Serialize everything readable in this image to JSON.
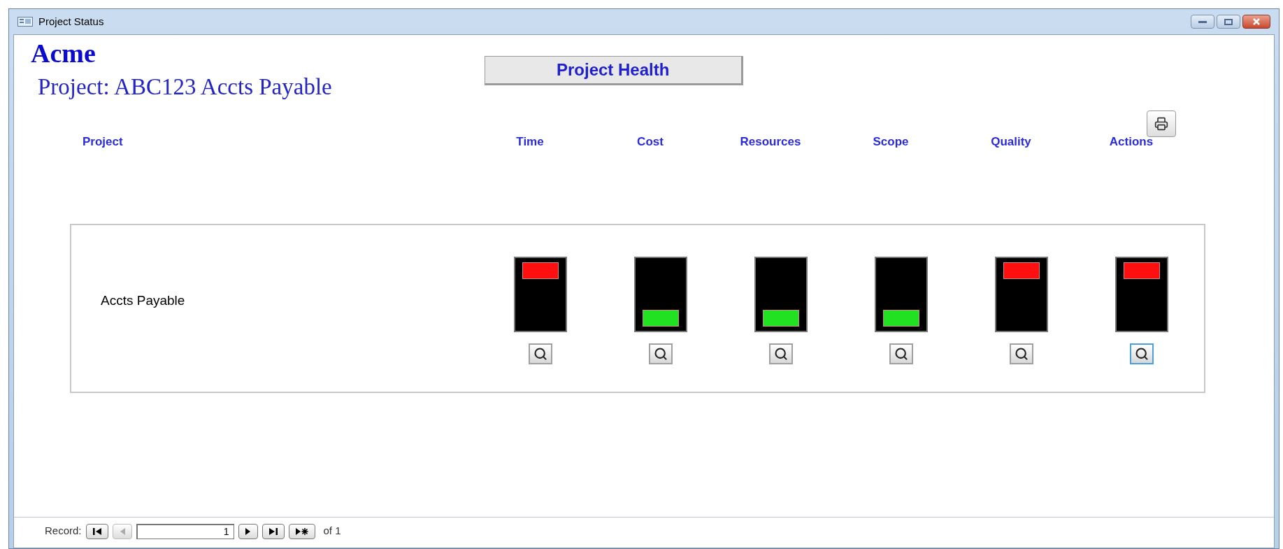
{
  "window": {
    "title": "Project Status"
  },
  "company": "Acme",
  "project_title": "Project: ABC123 Accts Payable",
  "health_button": "Project Health",
  "columns": [
    {
      "label": "Project"
    },
    {
      "label": "Time"
    },
    {
      "label": "Cost"
    },
    {
      "label": "Resources"
    },
    {
      "label": "Scope"
    },
    {
      "label": "Quality"
    },
    {
      "label": "Actions"
    }
  ],
  "rows": [
    {
      "name": "Accts Payable",
      "indicators": [
        {
          "kind": "alert",
          "focused": false
        },
        {
          "kind": "ok",
          "focused": false
        },
        {
          "kind": "ok",
          "focused": false
        },
        {
          "kind": "ok",
          "focused": false
        },
        {
          "kind": "alert",
          "focused": false
        },
        {
          "kind": "alert",
          "focused": true
        }
      ]
    }
  ],
  "record_nav": {
    "label": "Record:",
    "current": "1",
    "total": "of 1",
    "prev_disabled": true
  }
}
